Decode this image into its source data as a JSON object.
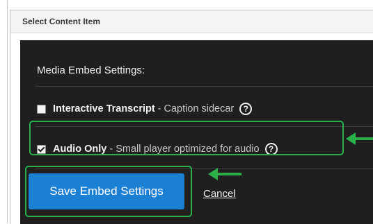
{
  "dialog": {
    "title": "Select Content Item"
  },
  "settings": {
    "section_title": "Media Embed Settings:",
    "options": [
      {
        "label": "Interactive Transcript",
        "separator": "-",
        "description": "Caption sidecar",
        "checked": false,
        "help_glyph": "?"
      },
      {
        "label": "Audio Only",
        "separator": "-",
        "description": "Small player optimized for audio",
        "checked": true,
        "help_glyph": "?"
      }
    ]
  },
  "actions": {
    "save_label": "Save Embed Settings",
    "cancel_label": "Cancel"
  },
  "colors": {
    "panel_background": "#1f1f1f",
    "accent_button": "#1b7fd4",
    "highlight_green": "#2bb04a"
  },
  "icons": {
    "help": "question-circle-icon",
    "annotation": "arrow-left-icon"
  }
}
